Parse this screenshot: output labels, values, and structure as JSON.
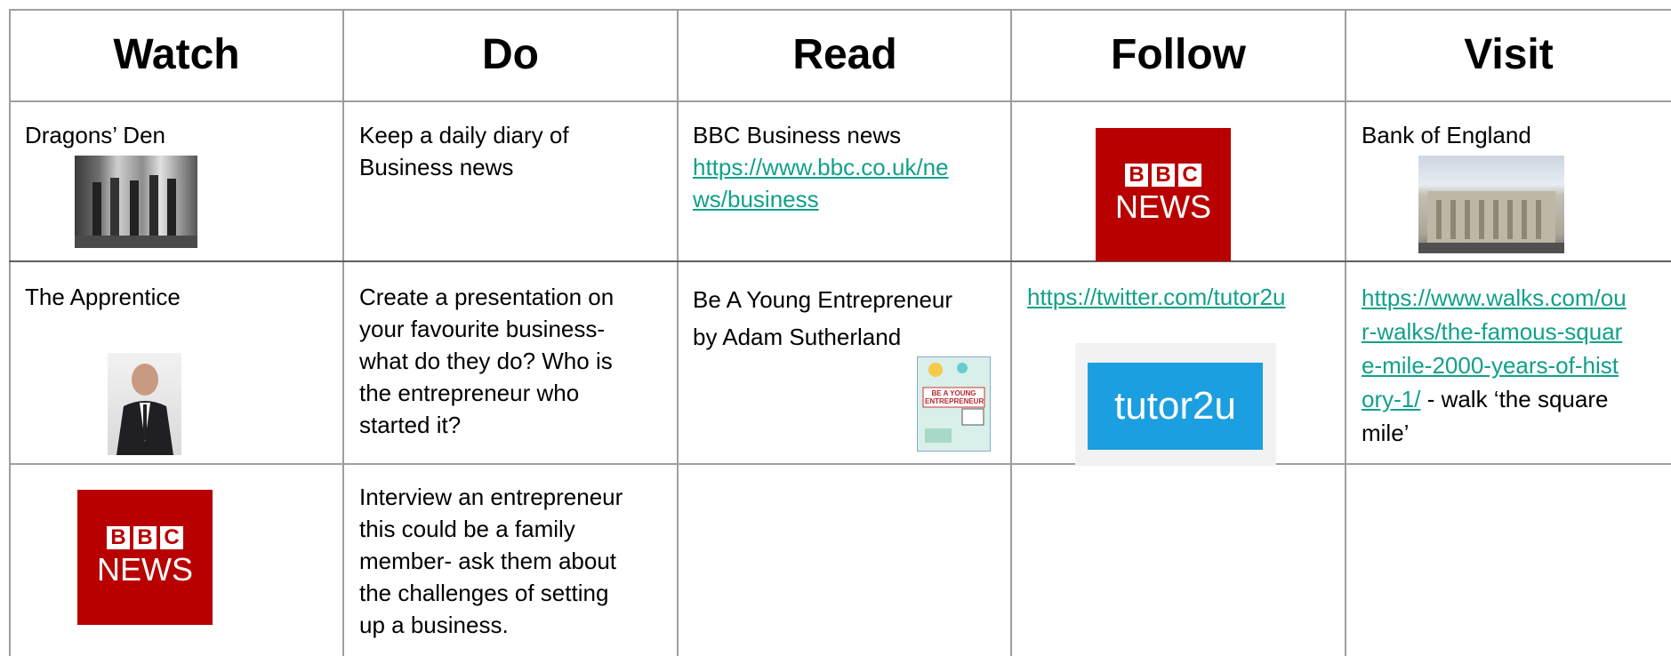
{
  "headers": [
    "Watch",
    "Do",
    "Read",
    "Follow",
    "Visit"
  ],
  "row1": {
    "watch": "Dragons’ Den",
    "do": "Keep a daily diary of Business news",
    "read_title": "BBC Business news",
    "read_link_line1": "https://www.bbc.co.uk/ne",
    "read_link_line2": "ws/business",
    "visit": "Bank of England"
  },
  "row2": {
    "watch": "The Apprentice",
    "do_lines": [
      "Create a presentation on",
      "your favourite business-",
      "what do they do? Who is",
      "the entrepreneur who",
      "started it?"
    ],
    "read_lines": [
      "Be A Young Entrepreneur",
      "by Adam Sutherland"
    ],
    "follow_link": "https://twitter.com/tutor2u",
    "visit_link_lines": [
      "https://www.walks.com/ou",
      "r-walks/the-famous-squar",
      "e-mile-2000-years-of-hist",
      "ory-1/"
    ],
    "visit_suffix_line1": " - walk ‘the square",
    "visit_suffix_line2": "mile’"
  },
  "row3": {
    "do_lines": [
      "Interview an entrepreneur",
      "this could be a family",
      "member- ask them about",
      "the challenges of setting",
      "up a business."
    ]
  },
  "logos": {
    "bbc_blocks": [
      "B",
      "B",
      "C"
    ],
    "bbc_news": "NEWS",
    "tutor2u": "tutor2u",
    "book_title_line1": "BE A YOUNG",
    "book_title_line2": "ENTREPRENEUR"
  },
  "colors": {
    "link": "#11a08a",
    "bbc_red": "#b80000",
    "tutor_blue": "#1b9fe0",
    "grid": "#9e9e9e"
  }
}
